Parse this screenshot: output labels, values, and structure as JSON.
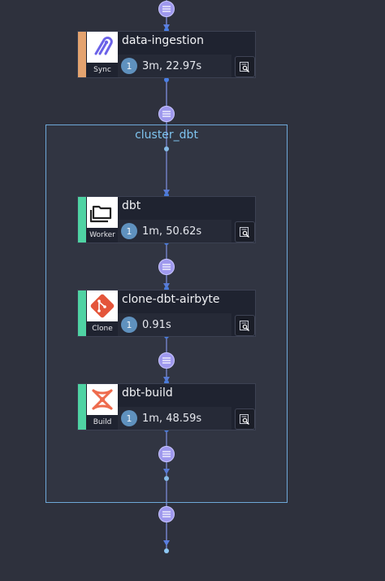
{
  "colors": {
    "sync_stripe": "#e4a36f",
    "dbt_stripe": "#4fd3a3",
    "lane": "#9f99ee",
    "cluster_border": "#6ea8d8",
    "count_badge": "#5f91be"
  },
  "cluster": {
    "label": "cluster_dbt"
  },
  "nodes": [
    {
      "title": "data-ingestion",
      "kind": "Sync",
      "count": "1",
      "duration": "3m, 22.97s",
      "icon": "airbyte-logo-icon"
    },
    {
      "title": "dbt",
      "kind": "Worker",
      "count": "1",
      "duration": "1m, 50.62s",
      "icon": "folders-icon"
    },
    {
      "title": "clone-dbt-airbyte",
      "kind": "Clone",
      "count": "1",
      "duration": "0.91s",
      "icon": "git-logo-icon"
    },
    {
      "title": "dbt-build",
      "kind": "Build",
      "count": "1",
      "duration": "1m, 48.59s",
      "icon": "dbt-logo-icon"
    }
  ]
}
